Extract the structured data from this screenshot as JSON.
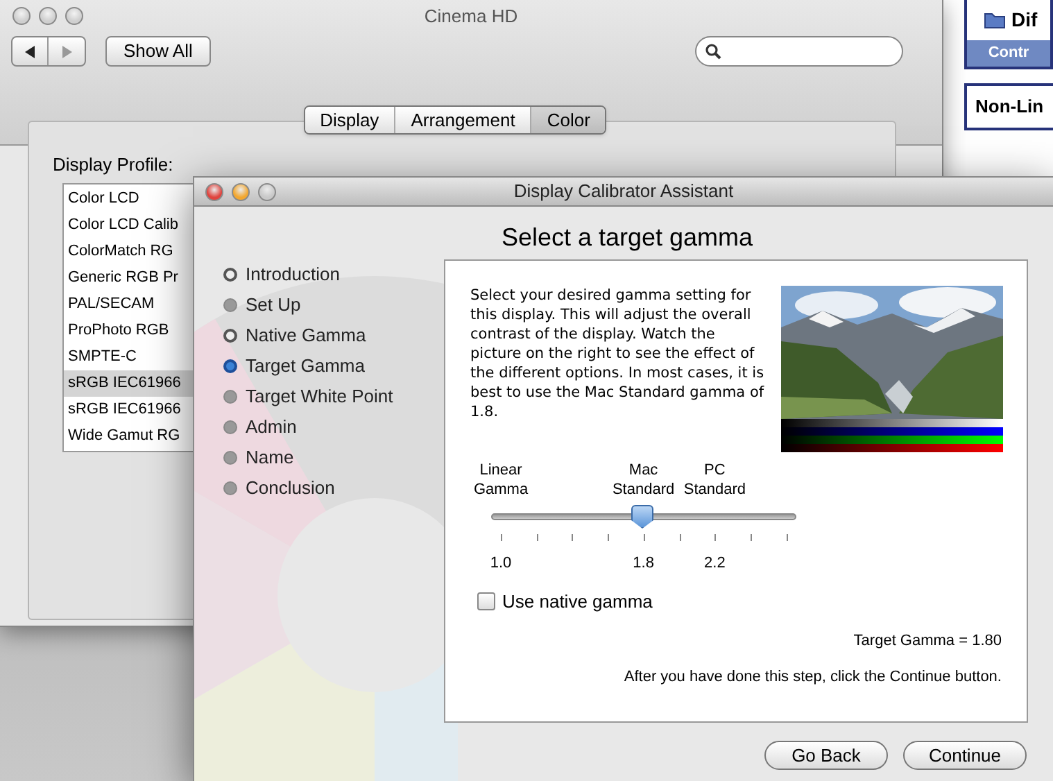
{
  "prefs_window": {
    "title": "Cinema HD",
    "show_all": "Show All",
    "tabs": [
      {
        "label": "Display",
        "selected": false
      },
      {
        "label": "Arrangement",
        "selected": false
      },
      {
        "label": "Color",
        "selected": true
      }
    ],
    "profile_label": "Display Profile:",
    "profiles": [
      {
        "label": "Color LCD",
        "selected": false
      },
      {
        "label": "Color LCD Calib",
        "selected": false
      },
      {
        "label": "ColorMatch RG",
        "selected": false
      },
      {
        "label": "Generic RGB Pr",
        "selected": false
      },
      {
        "label": "PAL/SECAM",
        "selected": false
      },
      {
        "label": "ProPhoto RGB",
        "selected": false
      },
      {
        "label": "SMPTE-C",
        "selected": false
      },
      {
        "label": "sRGB IEC61966",
        "selected": true
      },
      {
        "label": "sRGB IEC61966",
        "selected": false
      },
      {
        "label": "Wide Gamut RG",
        "selected": false
      }
    ]
  },
  "background_app": {
    "tree_item": "Dif",
    "header": "Contr",
    "box": "Non-Lin"
  },
  "calibrator": {
    "title": "Display Calibrator Assistant",
    "heading": "Select a target gamma",
    "steps": [
      {
        "label": "Introduction",
        "visited": true,
        "selected": false
      },
      {
        "label": "Set Up",
        "visited": false,
        "selected": false
      },
      {
        "label": "Native Gamma",
        "visited": true,
        "selected": false
      },
      {
        "label": "Target Gamma",
        "selected": true
      },
      {
        "label": "Target White Point",
        "visited": false,
        "selected": false
      },
      {
        "label": "Admin",
        "visited": false,
        "selected": false
      },
      {
        "label": "Name",
        "visited": false,
        "selected": false
      },
      {
        "label": "Conclusion",
        "visited": false,
        "selected": false
      }
    ],
    "description": "Select your desired gamma setting for this display. This will adjust the overall contrast of the display.  Watch the picture on the right to see the effect of the different options.  In most cases, it is best to use the Mac Standard gamma of 1.8.",
    "slider": {
      "level": 0.5,
      "captions": [
        {
          "line1": "Linear",
          "line2": "Gamma"
        },
        {
          "line1": "Mac",
          "line2": "Standard"
        },
        {
          "line1": "PC",
          "line2": "Standard"
        }
      ],
      "tick_labels": [
        "1.0",
        "1.8",
        "2.2"
      ]
    },
    "native_gamma": {
      "label": "Use native gamma",
      "checked": false
    },
    "readout": "Target Gamma = 1.80",
    "hint": "After you have done this step, click the Continue button.",
    "buttons": [
      {
        "label": "Go Back"
      },
      {
        "label": "Continue"
      }
    ]
  }
}
